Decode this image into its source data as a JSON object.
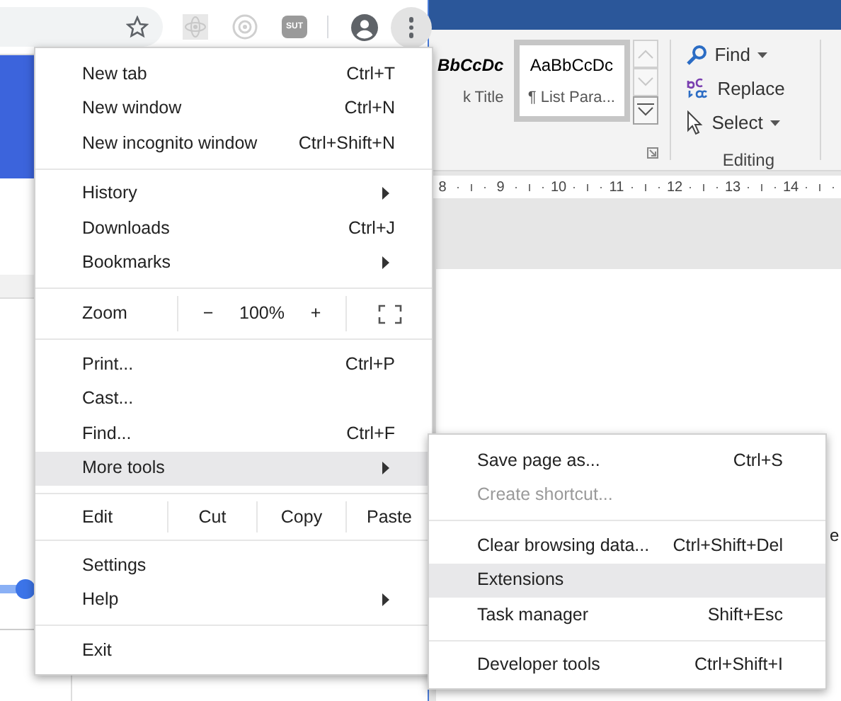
{
  "browser_toolbar": {
    "extension_badge": "SUT"
  },
  "word_ribbon": {
    "styles": [
      {
        "sample": "BbCcDc",
        "name": "k Title",
        "selected": false
      },
      {
        "sample": "AaBbCcDc",
        "name": "¶ List Para...",
        "selected": true
      }
    ],
    "editing": {
      "items": [
        {
          "label": "Find",
          "dropdown": true
        },
        {
          "label": "Replace",
          "dropdown": false
        },
        {
          "label": "Select",
          "dropdown": true
        }
      ],
      "group_label": "Editing"
    }
  },
  "ruler": [
    "8",
    "9",
    "10",
    "11",
    "12",
    "13",
    "14"
  ],
  "document_text": "e",
  "menu": [
    {
      "kind": "item",
      "label": "New tab",
      "shortcut": "Ctrl+T",
      "submenu": false,
      "selected": false
    },
    {
      "kind": "item",
      "label": "New window",
      "shortcut": "Ctrl+N",
      "submenu": false,
      "selected": false
    },
    {
      "kind": "item",
      "label": "New incognito window",
      "shortcut": "Ctrl+Shift+N",
      "submenu": false,
      "selected": false
    },
    {
      "kind": "separator"
    },
    {
      "kind": "item",
      "label": "History",
      "submenu": true,
      "selected": false
    },
    {
      "kind": "item",
      "label": "Downloads",
      "shortcut": "Ctrl+J",
      "submenu": false,
      "selected": false
    },
    {
      "kind": "item",
      "label": "Bookmarks",
      "submenu": true,
      "selected": false
    },
    {
      "kind": "separator"
    },
    {
      "kind": "zoom",
      "label": "Zoom",
      "minus": "−",
      "value": "100%",
      "plus": "+"
    },
    {
      "kind": "separator"
    },
    {
      "kind": "item",
      "label": "Print...",
      "shortcut": "Ctrl+P",
      "submenu": false,
      "selected": false
    },
    {
      "kind": "item",
      "label": "Cast...",
      "submenu": false,
      "selected": false
    },
    {
      "kind": "item",
      "label": "Find...",
      "shortcut": "Ctrl+F",
      "submenu": false,
      "selected": false
    },
    {
      "kind": "item",
      "label": "More tools",
      "submenu": true,
      "selected": true
    },
    {
      "kind": "separator"
    },
    {
      "kind": "edit",
      "label": "Edit",
      "buttons": [
        "Cut",
        "Copy",
        "Paste"
      ]
    },
    {
      "kind": "separator"
    },
    {
      "kind": "item",
      "label": "Settings",
      "submenu": false,
      "selected": false
    },
    {
      "kind": "item",
      "label": "Help",
      "submenu": true,
      "selected": false
    },
    {
      "kind": "separator"
    },
    {
      "kind": "item",
      "label": "Exit",
      "submenu": false,
      "selected": false
    }
  ],
  "submenu": [
    {
      "kind": "item",
      "label": "Save page as...",
      "shortcut": "Ctrl+S",
      "disabled": false,
      "selected": false
    },
    {
      "kind": "item",
      "label": "Create shortcut...",
      "disabled": true,
      "selected": false
    },
    {
      "kind": "separator"
    },
    {
      "kind": "item",
      "label": "Clear browsing data...",
      "shortcut": "Ctrl+Shift+Del",
      "disabled": false,
      "selected": false
    },
    {
      "kind": "item",
      "label": "Extensions",
      "disabled": false,
      "selected": true
    },
    {
      "kind": "item",
      "label": "Task manager",
      "shortcut": "Shift+Esc",
      "disabled": false,
      "selected": false
    },
    {
      "kind": "separator"
    },
    {
      "kind": "item",
      "label": "Developer tools",
      "shortcut": "Ctrl+Shift+I",
      "disabled": false,
      "selected": false
    }
  ]
}
